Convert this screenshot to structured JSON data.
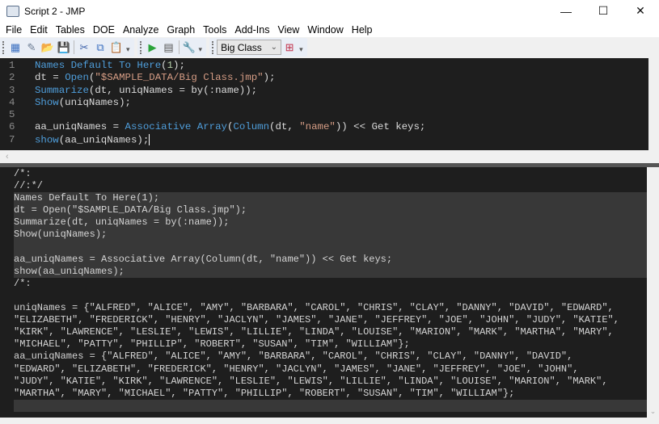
{
  "window": {
    "title": "Script 2 - JMP",
    "minimize": "—",
    "maximize": "☐",
    "close": "✕"
  },
  "menu": [
    "File",
    "Edit",
    "Tables",
    "DOE",
    "Analyze",
    "Graph",
    "Tools",
    "Add-Ins",
    "View",
    "Window",
    "Help"
  ],
  "toolbar": {
    "table_select": "Big Class",
    "dropdown_arrow": "⌄"
  },
  "editor": {
    "lines": [
      {
        "n": "1",
        "tokens": [
          [
            "kw",
            "Names Default To Here"
          ],
          [
            "txt",
            "("
          ],
          [
            "num",
            "1"
          ],
          [
            "txt",
            ");"
          ]
        ]
      },
      {
        "n": "2",
        "tokens": [
          [
            "txt",
            "dt = "
          ],
          [
            "kw",
            "Open"
          ],
          [
            "txt",
            "("
          ],
          [
            "str",
            "\"$SAMPLE_DATA/Big Class.jmp\""
          ],
          [
            "txt",
            ");"
          ]
        ]
      },
      {
        "n": "3",
        "tokens": [
          [
            "kw",
            "Summarize"
          ],
          [
            "txt",
            "(dt, uniqNames = by(:name));"
          ]
        ]
      },
      {
        "n": "4",
        "tokens": [
          [
            "kw",
            "Show"
          ],
          [
            "txt",
            "(uniqNames);"
          ]
        ]
      },
      {
        "n": "5",
        "tokens": []
      },
      {
        "n": "6",
        "tokens": [
          [
            "txt",
            "aa_uniqNames = "
          ],
          [
            "kw",
            "Associative Array"
          ],
          [
            "txt",
            "("
          ],
          [
            "kw",
            "Column"
          ],
          [
            "txt",
            "(dt, "
          ],
          [
            "str",
            "\"name\""
          ],
          [
            "txt",
            "))"
          ],
          [
            "txt",
            " << Get keys;"
          ]
        ]
      },
      {
        "n": "7",
        "tokens": [
          [
            "kw",
            "show"
          ],
          [
            "txt",
            "(aa_uniqNames);"
          ]
        ]
      }
    ]
  },
  "log": {
    "lines": [
      {
        "t": "/*:",
        "k": ""
      },
      {
        "t": "//:*/",
        "k": ""
      },
      {
        "t": "Names Default To Here(1);",
        "k": "hl"
      },
      {
        "t": "dt = Open(\"$SAMPLE_DATA/Big Class.jmp\");",
        "k": "hl"
      },
      {
        "t": "Summarize(dt, uniqNames = by(:name));",
        "k": "hl"
      },
      {
        "t": "Show(uniqNames);",
        "k": "hl"
      },
      {
        "t": " ",
        "k": "hl"
      },
      {
        "t": "aa_uniqNames = Associative Array(Column(dt, \"name\")) << Get keys;",
        "k": "hl"
      },
      {
        "t": "show(aa_uniqNames);",
        "k": "hl"
      },
      {
        "t": "/*:",
        "k": ""
      },
      {
        "t": " ",
        "k": ""
      },
      {
        "t": "uniqNames = {\"ALFRED\", \"ALICE\", \"AMY\", \"BARBARA\", \"CAROL\", \"CHRIS\", \"CLAY\", \"DANNY\", \"DAVID\", \"EDWARD\",",
        "k": "out"
      },
      {
        "t": "\"ELIZABETH\", \"FREDERICK\", \"HENRY\", \"JACLYN\", \"JAMES\", \"JANE\", \"JEFFREY\", \"JOE\", \"JOHN\", \"JUDY\", \"KATIE\",",
        "k": "out"
      },
      {
        "t": "\"KIRK\", \"LAWRENCE\", \"LESLIE\", \"LEWIS\", \"LILLIE\", \"LINDA\", \"LOUISE\", \"MARION\", \"MARK\", \"MARTHA\", \"MARY\",",
        "k": "out"
      },
      {
        "t": "\"MICHAEL\", \"PATTY\", \"PHILLIP\", \"ROBERT\", \"SUSAN\", \"TIM\", \"WILLIAM\"};",
        "k": "out"
      },
      {
        "t": "aa_uniqNames = {\"ALFRED\", \"ALICE\", \"AMY\", \"BARBARA\", \"CAROL\", \"CHRIS\", \"CLAY\", \"DANNY\", \"DAVID\",",
        "k": "out"
      },
      {
        "t": "\"EDWARD\", \"ELIZABETH\", \"FREDERICK\", \"HENRY\", \"JACLYN\", \"JAMES\", \"JANE\", \"JEFFREY\", \"JOE\", \"JOHN\",",
        "k": "out"
      },
      {
        "t": "\"JUDY\", \"KATIE\", \"KIRK\", \"LAWRENCE\", \"LESLIE\", \"LEWIS\", \"LILLIE\", \"LINDA\", \"LOUISE\", \"MARION\", \"MARK\",",
        "k": "out"
      },
      {
        "t": "\"MARTHA\", \"MARY\", \"MICHAEL\", \"PATTY\", \"PHILLIP\", \"ROBERT\", \"SUSAN\", \"TIM\", \"WILLIAM\"};",
        "k": "out"
      },
      {
        "t": " ",
        "k": "hl"
      }
    ]
  },
  "scroll": {
    "left_arrow": "‹",
    "down_arrow": "⌄"
  }
}
